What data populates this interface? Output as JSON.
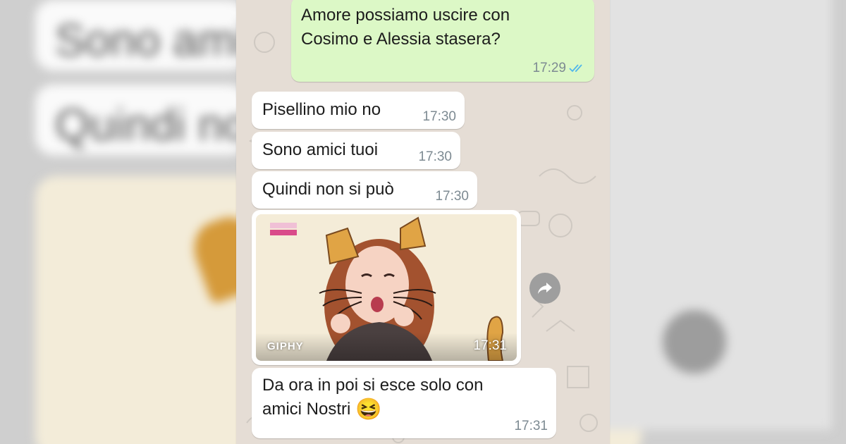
{
  "background": {
    "blur_line_1": "Sono amici tuoi",
    "blur_line_2": "Quindi non si può"
  },
  "messages": [
    {
      "direction": "outgoing",
      "lines": [
        "Amore possiamo uscire con",
        "Cosimo e Alessia stasera?"
      ],
      "time": "17:29",
      "status": "read"
    },
    {
      "direction": "incoming",
      "text": "Pisellino mio no",
      "time": "17:30"
    },
    {
      "direction": "incoming",
      "text": "Sono amici tuoi",
      "time": "17:30"
    },
    {
      "direction": "incoming",
      "text": "Quindi non si può",
      "time": "17:30"
    },
    {
      "direction": "incoming",
      "type": "gif",
      "badge": "GIPHY",
      "time": "17:31"
    },
    {
      "direction": "incoming",
      "lines": [
        "Da ora in poi si esce solo con",
        "amici Nostri"
      ],
      "emoji": "😆",
      "time": "17:31"
    }
  ],
  "icons": {
    "forward": "forward-icon",
    "read_receipt": "double-check-icon"
  },
  "colors": {
    "outgoing_bubble": "#dcf8c6",
    "incoming_bubble": "#ffffff",
    "chat_background": "#e5ddd5",
    "read_tick": "#4fb6ec",
    "timestamp": "#7d8a92"
  }
}
